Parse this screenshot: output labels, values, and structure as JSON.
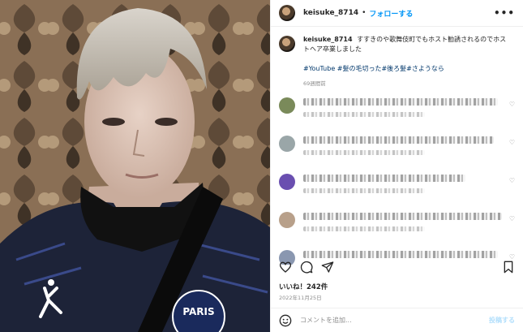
{
  "header": {
    "username": "keisuke_8714",
    "separator": "•",
    "follow_label": "フォローする",
    "more_label": "•••"
  },
  "caption": {
    "username": "keisuke_8714",
    "text": "すすきのや歌舞伎町でもホスト勧誘されるのでホストヘア卒業しました",
    "tags": "#YouTube #髪の毛切った#後ろ髪#さようなら",
    "age": "69週間前"
  },
  "comments": [
    {
      "avatar_color": "#7a8a5a"
    },
    {
      "avatar_color": "#9aa6a8"
    },
    {
      "avatar_color": "#6a4fb0"
    },
    {
      "avatar_color": "#b8a08a"
    },
    {
      "avatar_color": "#8a97b0"
    }
  ],
  "stats": {
    "likes": "いいね！242件",
    "date": "2022年11月25日"
  },
  "add_comment": {
    "placeholder": "コメントを追加...",
    "post_label": "投稿する"
  },
  "photo": {
    "shirt_logo_text": "PARIS"
  }
}
